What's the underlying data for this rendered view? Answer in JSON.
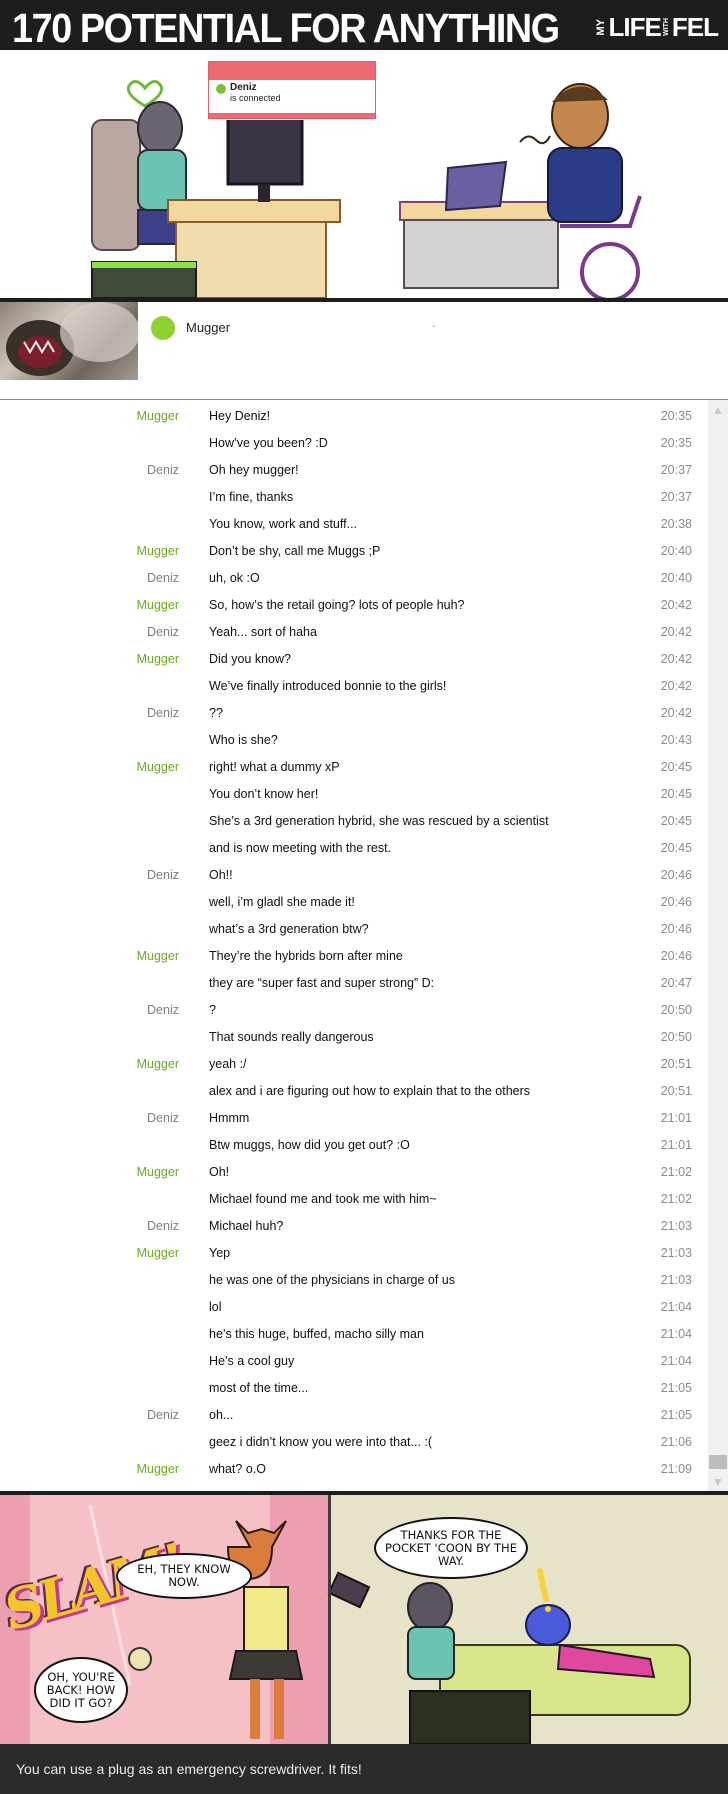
{
  "header": {
    "title": "170 POTENTIAL FOR ANYTHING",
    "logo": {
      "my": "MY",
      "life": "LIFE",
      "with": "WITH",
      "fel": "FEL"
    }
  },
  "notification": {
    "name": "Deniz",
    "status": "is connected"
  },
  "contact": {
    "name": "Mugger",
    "status": "-"
  },
  "colors": {
    "mugger": "#68ad22",
    "deniz": "#7d7d7d",
    "accent": "#8fd12f",
    "notify": "#ec6a72"
  },
  "messages": [
    {
      "sender": "Mugger",
      "text": "Hey Deniz!",
      "time": "20:35"
    },
    {
      "sender": "",
      "text": "How’ve you been? :D",
      "time": "20:35"
    },
    {
      "sender": "Deniz",
      "text": "Oh hey mugger!",
      "time": "20:37"
    },
    {
      "sender": "",
      "text": "I’m fine, thanks",
      "time": "20:37"
    },
    {
      "sender": "",
      "text": "You know, work and stuff...",
      "time": "20:38"
    },
    {
      "sender": "Mugger",
      "text": "Don’t be shy, call me Muggs ;P",
      "time": "20:40"
    },
    {
      "sender": "Deniz",
      "text": "uh, ok :O",
      "time": "20:40"
    },
    {
      "sender": "Mugger",
      "text": "So, how’s the retail going? lots of people huh?",
      "time": "20:42"
    },
    {
      "sender": "Deniz",
      "text": "Yeah... sort of haha",
      "time": "20:42"
    },
    {
      "sender": "Mugger",
      "text": "Did you know?",
      "time": "20:42"
    },
    {
      "sender": "",
      "text": "We’ve finally introduced bonnie to the girls!",
      "time": "20:42"
    },
    {
      "sender": "Deniz",
      "text": "??",
      "time": "20:42"
    },
    {
      "sender": "",
      "text": "Who is she?",
      "time": "20:43"
    },
    {
      "sender": "Mugger",
      "text": "right! what a dummy xP",
      "time": "20:45"
    },
    {
      "sender": "",
      "text": "You don’t know her!",
      "time": "20:45"
    },
    {
      "sender": "",
      "text": "She’s a 3rd generation hybrid, she was rescued by a scientist",
      "time": "20:45"
    },
    {
      "sender": "",
      "text": "and is now meeting with the rest.",
      "time": "20:45"
    },
    {
      "sender": "Deniz",
      "text": "Oh!!",
      "time": "20:46"
    },
    {
      "sender": "",
      "text": "well, i’m gladl she made it!",
      "time": "20:46"
    },
    {
      "sender": "",
      "text": "what’s a 3rd generation btw?",
      "time": "20:46"
    },
    {
      "sender": "Mugger",
      "text": "They’re the hybrids born after mine",
      "time": "20:46"
    },
    {
      "sender": "",
      "text": "they are “super fast and super strong” D:",
      "time": "20:47"
    },
    {
      "sender": "Deniz",
      "text": "?",
      "time": "20:50"
    },
    {
      "sender": "",
      "text": "That sounds really dangerous",
      "time": "20:50"
    },
    {
      "sender": "Mugger",
      "text": "yeah :/",
      "time": "20:51"
    },
    {
      "sender": "",
      "text": "alex and i are figuring out how to explain that to the others",
      "time": "20:51"
    },
    {
      "sender": "Deniz",
      "text": "Hmmm",
      "time": "21:01"
    },
    {
      "sender": "",
      "text": "Btw muggs, how did you get out? :O",
      "time": "21:01"
    },
    {
      "sender": "Mugger",
      "text": "Oh!",
      "time": "21:02"
    },
    {
      "sender": "",
      "text": "Michael found me and took me with him~",
      "time": "21:02"
    },
    {
      "sender": "Deniz",
      "text": "Michael huh?",
      "time": "21:03"
    },
    {
      "sender": "Mugger",
      "text": "Yep",
      "time": "21:03"
    },
    {
      "sender": "",
      "text": "he was one of the physicians in charge of us",
      "time": "21:03"
    },
    {
      "sender": "",
      "text": "lol",
      "time": "21:04"
    },
    {
      "sender": "",
      "text": "he’s this huge, buffed, macho silly man",
      "time": "21:04"
    },
    {
      "sender": "",
      "text": "He’s a cool guy",
      "time": "21:04"
    },
    {
      "sender": "",
      "text": "most of the time...",
      "time": "21:05"
    },
    {
      "sender": "Deniz",
      "text": "oh...",
      "time": "21:05"
    },
    {
      "sender": "",
      "text": "geez i didn’t know you were into that... :(",
      "time": "21:06"
    },
    {
      "sender": "Mugger",
      "text": "what? o.O",
      "time": "21:09"
    }
  ],
  "comic": {
    "sfx": "SLAM!",
    "bubble_they_know": "EH, THEY KNOW NOW.",
    "bubble_back": "OH, YOU'RE BACK! HOW DID IT GO?",
    "bubble_thanks": "THANKS FOR THE POCKET 'COON BY THE WAY."
  },
  "footer": {
    "text": "You can use a plug as an emergency screwdriver. It fits!"
  },
  "icons": {
    "scroll_up": "chevron-up-icon",
    "scroll_down": "chevron-down-icon",
    "status_dot": "online-dot-icon"
  }
}
